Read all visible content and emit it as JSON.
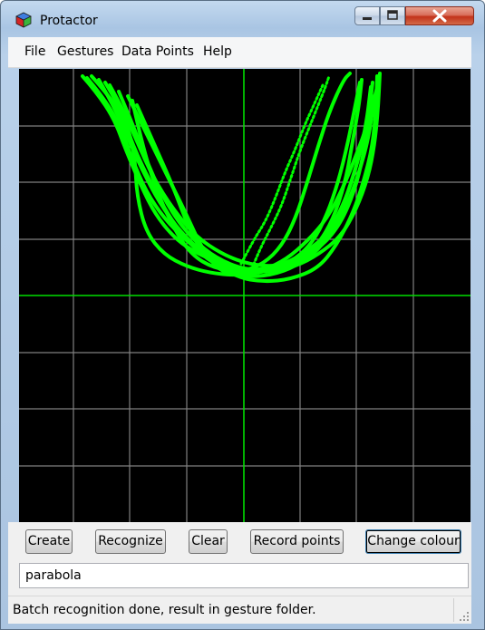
{
  "window": {
    "title": "Protactor"
  },
  "menu": {
    "items": [
      "File",
      "Gestures",
      "Data Points",
      "Help"
    ]
  },
  "buttons": {
    "create": "Create",
    "recognize": "Recognize",
    "clear": "Clear",
    "record_points": "Record points",
    "change_colour": "Change colour"
  },
  "gesture_name": {
    "value": "parabola"
  },
  "status": {
    "text": "Batch recognition done, result in gesture folder."
  },
  "colors": {
    "gesture_points": "#00ff00",
    "axis_lines": "#00e000",
    "grid_lines": "#808080",
    "canvas_background": "#000000"
  },
  "icons": {
    "app": "app-cube-icon",
    "minimize": "minimize-icon",
    "maximize": "maximize-icon",
    "close": "close-icon",
    "size_grip": "resize-grip-icon"
  }
}
